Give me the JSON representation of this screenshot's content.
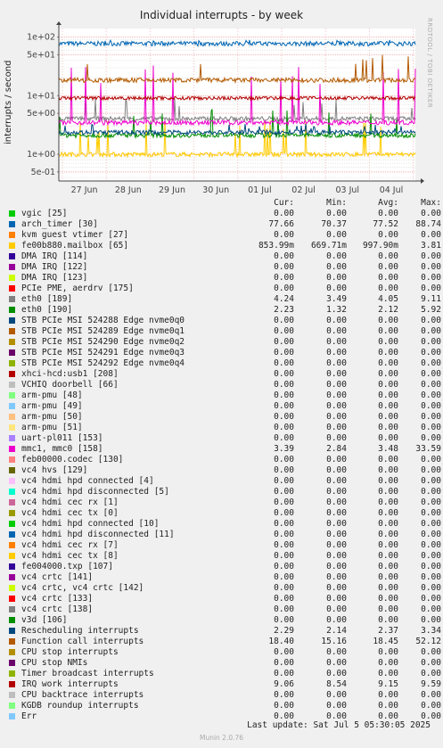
{
  "side_credit": "RRDTOOL / TOBI OETIKER",
  "munin_version": "Munin 2.0.76",
  "last_update": "Last update:  Sat Jul  5 05:30:05 2025",
  "chart_data": {
    "type": "line",
    "title": "Individual interrupts - by week",
    "ylabel": "interrupts / second",
    "xlabel": "",
    "yscale": "log",
    "ylim": [
      0.35,
      140
    ],
    "y_ticks": [
      {
        "value": 100,
        "label": "1e+02"
      },
      {
        "value": 50,
        "label": "5e+01"
      },
      {
        "value": 10,
        "label": "1e+01"
      },
      {
        "value": 5,
        "label": "5e+00"
      },
      {
        "value": 1,
        "label": "1e+00"
      },
      {
        "value": 0.5,
        "label": "5e-01"
      }
    ],
    "x_ticks": [
      "27 Jun",
      "28 Jun",
      "29 Jun",
      "30 Jun",
      "01 Jul",
      "02 Jul",
      "03 Jul",
      "04 Jul"
    ],
    "grid": true,
    "columns": [
      "Cur:",
      "Min:",
      "Avg:",
      "Max:"
    ],
    "series": [
      {
        "name": "vgic [25]",
        "color": "#00cc00",
        "cur": "0.00",
        "min": "0.00",
        "avg": "0.00",
        "max": "0.00"
      },
      {
        "name": "arch_timer [30]",
        "color": "#0066b3",
        "cur": "77.66",
        "min": "70.37",
        "avg": "77.52",
        "max": "88.74",
        "plotted": true
      },
      {
        "name": "kvm guest vtimer [27]",
        "color": "#ff8000",
        "cur": "0.00",
        "min": "0.00",
        "avg": "0.00",
        "max": "0.00"
      },
      {
        "name": "fe00b880.mailbox [65]",
        "color": "#ffcc00",
        "cur": "853.99m",
        "min": "669.71m",
        "avg": "997.90m",
        "max": "3.81",
        "plotted": true
      },
      {
        "name": "DMA IRQ [114]",
        "color": "#330099",
        "cur": "0.00",
        "min": "0.00",
        "avg": "0.00",
        "max": "0.00"
      },
      {
        "name": "DMA IRQ [122]",
        "color": "#990099",
        "cur": "0.00",
        "min": "0.00",
        "avg": "0.00",
        "max": "0.00"
      },
      {
        "name": "DMA IRQ [123]",
        "color": "#ccff00",
        "cur": "0.00",
        "min": "0.00",
        "avg": "0.00",
        "max": "0.00"
      },
      {
        "name": "PCIe PME, aerdrv [175]",
        "color": "#ff0000",
        "cur": "0.00",
        "min": "0.00",
        "avg": "0.00",
        "max": "0.00"
      },
      {
        "name": "eth0 [189]",
        "color": "#808080",
        "cur": "4.24",
        "min": "3.49",
        "avg": "4.05",
        "max": "9.11",
        "plotted": true
      },
      {
        "name": "eth0 [190]",
        "color": "#008f00",
        "cur": "2.23",
        "min": "1.32",
        "avg": "2.12",
        "max": "5.92",
        "plotted": true
      },
      {
        "name": "STB PCIe MSI 524288 Edge      nvme0q0",
        "color": "#00487d",
        "cur": "0.00",
        "min": "0.00",
        "avg": "0.00",
        "max": "0.00"
      },
      {
        "name": "STB PCIe MSI 524289 Edge      nvme0q1",
        "color": "#b35a00",
        "cur": "0.00",
        "min": "0.00",
        "avg": "0.00",
        "max": "0.00"
      },
      {
        "name": "STB PCIe MSI 524290 Edge      nvme0q2",
        "color": "#b38f00",
        "cur": "0.00",
        "min": "0.00",
        "avg": "0.00",
        "max": "0.00"
      },
      {
        "name": "STB PCIe MSI 524291 Edge      nvme0q3",
        "color": "#6b006b",
        "cur": "0.00",
        "min": "0.00",
        "avg": "0.00",
        "max": "0.00"
      },
      {
        "name": "STB PCIe MSI 524292 Edge      nvme0q4",
        "color": "#8fb300",
        "cur": "0.00",
        "min": "0.00",
        "avg": "0.00",
        "max": "0.00"
      },
      {
        "name": "xhci-hcd:usb1 [208]",
        "color": "#b30000",
        "cur": "0.00",
        "min": "0.00",
        "avg": "0.00",
        "max": "0.00"
      },
      {
        "name": "VCHIQ doorbell [66]",
        "color": "#bebebe",
        "cur": "0.00",
        "min": "0.00",
        "avg": "0.00",
        "max": "0.00"
      },
      {
        "name": "arm-pmu [48]",
        "color": "#80ff80",
        "cur": "0.00",
        "min": "0.00",
        "avg": "0.00",
        "max": "0.00"
      },
      {
        "name": "arm-pmu [49]",
        "color": "#80c9ff",
        "cur": "0.00",
        "min": "0.00",
        "avg": "0.00",
        "max": "0.00"
      },
      {
        "name": "arm-pmu [50]",
        "color": "#ffc080",
        "cur": "0.00",
        "min": "0.00",
        "avg": "0.00",
        "max": "0.00"
      },
      {
        "name": "arm-pmu [51]",
        "color": "#ffe680",
        "cur": "0.00",
        "min": "0.00",
        "avg": "0.00",
        "max": "0.00"
      },
      {
        "name": "uart-pl011 [153]",
        "color": "#aa80ff",
        "cur": "0.00",
        "min": "0.00",
        "avg": "0.00",
        "max": "0.00"
      },
      {
        "name": "mmc1, mmc0 [158]",
        "color": "#ee00cc",
        "cur": "3.39",
        "min": "2.84",
        "avg": "3.48",
        "max": "33.59",
        "plotted": true
      },
      {
        "name": "feb00000.codec [130]",
        "color": "#ff8080",
        "cur": "0.00",
        "min": "0.00",
        "avg": "0.00",
        "max": "0.00"
      },
      {
        "name": "vc4 hvs [129]",
        "color": "#666600",
        "cur": "0.00",
        "min": "0.00",
        "avg": "0.00",
        "max": "0.00"
      },
      {
        "name": "vc4 hdmi hpd connected [4]",
        "color": "#ffbfff",
        "cur": "0.00",
        "min": "0.00",
        "avg": "0.00",
        "max": "0.00"
      },
      {
        "name": "vc4 hdmi hpd disconnected [5]",
        "color": "#00ffcc",
        "cur": "0.00",
        "min": "0.00",
        "avg": "0.00",
        "max": "0.00"
      },
      {
        "name": "vc4 hdmi cec rx [1]",
        "color": "#cc6699",
        "cur": "0.00",
        "min": "0.00",
        "avg": "0.00",
        "max": "0.00"
      },
      {
        "name": "vc4 hdmi cec tx [0]",
        "color": "#999900",
        "cur": "0.00",
        "min": "0.00",
        "avg": "0.00",
        "max": "0.00"
      },
      {
        "name": "vc4 hdmi hpd connected [10]",
        "color": "#00cc00",
        "cur": "0.00",
        "min": "0.00",
        "avg": "0.00",
        "max": "0.00"
      },
      {
        "name": "vc4 hdmi hpd disconnected [11]",
        "color": "#0066b3",
        "cur": "0.00",
        "min": "0.00",
        "avg": "0.00",
        "max": "0.00"
      },
      {
        "name": "vc4 hdmi cec rx [7]",
        "color": "#ff8000",
        "cur": "0.00",
        "min": "0.00",
        "avg": "0.00",
        "max": "0.00"
      },
      {
        "name": "vc4 hdmi cec tx [8]",
        "color": "#ffcc00",
        "cur": "0.00",
        "min": "0.00",
        "avg": "0.00",
        "max": "0.00"
      },
      {
        "name": "fe004000.txp [107]",
        "color": "#330099",
        "cur": "0.00",
        "min": "0.00",
        "avg": "0.00",
        "max": "0.00"
      },
      {
        "name": "vc4 crtc [141]",
        "color": "#990099",
        "cur": "0.00",
        "min": "0.00",
        "avg": "0.00",
        "max": "0.00"
      },
      {
        "name": "vc4 crtc, vc4 crtc [142]",
        "color": "#ccff00",
        "cur": "0.00",
        "min": "0.00",
        "avg": "0.00",
        "max": "0.00"
      },
      {
        "name": "vc4 crtc [133]",
        "color": "#ff0000",
        "cur": "0.00",
        "min": "0.00",
        "avg": "0.00",
        "max": "0.00"
      },
      {
        "name": "vc4 crtc [138]",
        "color": "#808080",
        "cur": "0.00",
        "min": "0.00",
        "avg": "0.00",
        "max": "0.00"
      },
      {
        "name": "v3d [106]",
        "color": "#008f00",
        "cur": "0.00",
        "min": "0.00",
        "avg": "0.00",
        "max": "0.00"
      },
      {
        "name": "Rescheduling interrupts",
        "color": "#00487d",
        "cur": "2.29",
        "min": "2.14",
        "avg": "2.37",
        "max": "3.34",
        "plotted": true
      },
      {
        "name": "Function call interrupts",
        "color": "#b35a00",
        "cur": "18.40",
        "min": "15.16",
        "avg": "18.45",
        "max": "52.12",
        "plotted": true
      },
      {
        "name": "CPU stop interrupts",
        "color": "#b38f00",
        "cur": "0.00",
        "min": "0.00",
        "avg": "0.00",
        "max": "0.00"
      },
      {
        "name": "CPU stop NMIs",
        "color": "#6b006b",
        "cur": "0.00",
        "min": "0.00",
        "avg": "0.00",
        "max": "0.00"
      },
      {
        "name": "Timer broadcast interrupts",
        "color": "#8fb300",
        "cur": "0.00",
        "min": "0.00",
        "avg": "0.00",
        "max": "0.00"
      },
      {
        "name": "IRQ work interrupts",
        "color": "#b30000",
        "cur": "9.06",
        "min": "8.54",
        "avg": "9.15",
        "max": "9.59",
        "plotted": true
      },
      {
        "name": "CPU backtrace interrupts",
        "color": "#bebebe",
        "cur": "0.00",
        "min": "0.00",
        "avg": "0.00",
        "max": "0.00"
      },
      {
        "name": "KGDB roundup interrupts",
        "color": "#80ff80",
        "cur": "0.00",
        "min": "0.00",
        "avg": "0.00",
        "max": "0.00"
      },
      {
        "name": "Err",
        "color": "#80c9ff",
        "cur": "0.00",
        "min": "0.00",
        "avg": "0.00",
        "max": "0.00"
      }
    ]
  }
}
